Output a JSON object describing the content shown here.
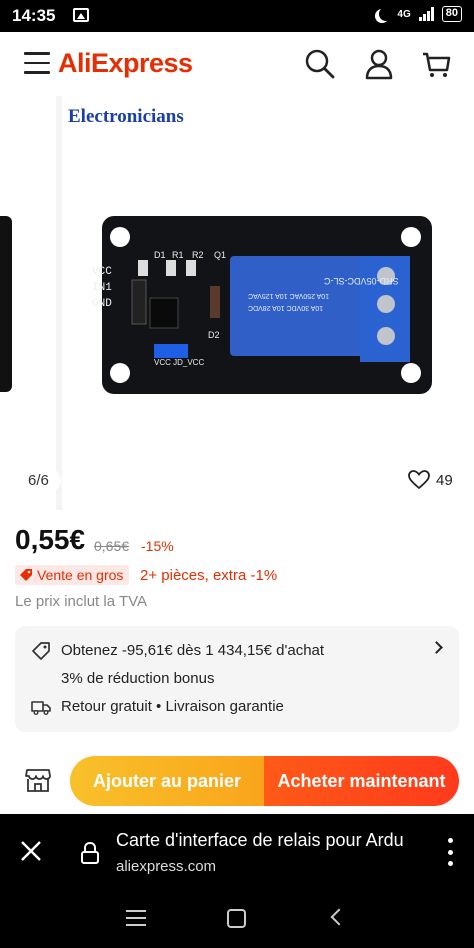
{
  "status_bar": {
    "time": "14:35",
    "network": "4G",
    "battery": "80"
  },
  "header": {
    "logo": "AliExpress",
    "icons": [
      "menu-icon",
      "search-icon",
      "account-icon",
      "cart-icon"
    ]
  },
  "gallery": {
    "brand_watermark": "Electronicians",
    "counter": "6/6",
    "likes": "49",
    "board_labels": {
      "pins": [
        "VCC",
        "IN1",
        "GND"
      ],
      "components": [
        "D1",
        "R1",
        "R2",
        "Q1",
        "D2"
      ],
      "jumper": "VCC JD_VCC",
      "relay_model": "SRD-05VDC-SL-C",
      "relay_specs": [
        "10A 250VAC 10A 125VAC",
        "10A 30VDC 10A 28VDC"
      ]
    }
  },
  "product": {
    "price": "0,55€",
    "original_price": "0,65€",
    "discount": "-15%",
    "bulk_badge": "Vente en gros",
    "bulk_offer": "2+ pièces, extra -1%",
    "vat_note": "Le prix inclut la TVA"
  },
  "offers": {
    "coupon_line": "Obtenez -95,61€ dès 1 434,15€ d'achat",
    "bonus_line": "3% de réduction bonus",
    "return_line": "Retour gratuit • Livraison garantie"
  },
  "actions": {
    "add_to_cart": "Ajouter au panier",
    "buy_now": "Acheter maintenant"
  },
  "browser": {
    "title": "Carte d'interface de relais pour Ardu",
    "url": "aliexpress.com"
  },
  "colors": {
    "brand": "#e62e04",
    "cart_button": "#f9b21f",
    "buy_button": "#ff4a1a"
  }
}
